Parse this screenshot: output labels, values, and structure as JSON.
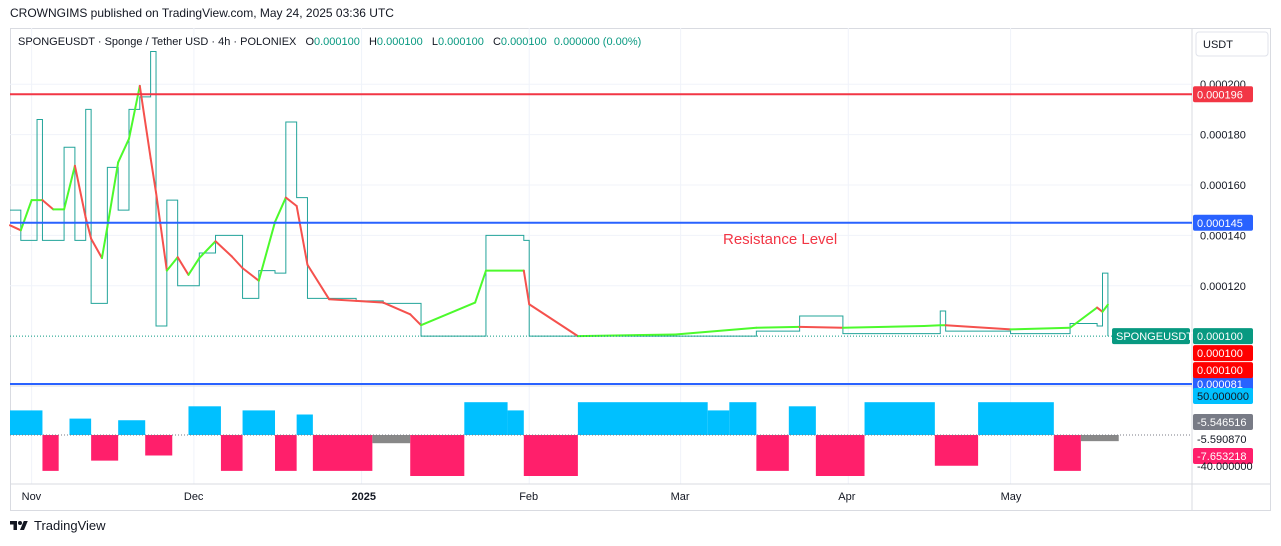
{
  "header": {
    "published": "CROWNGIMS published on TradingView.com, May 24, 2025 03:36 UTC"
  },
  "legend": {
    "symbol": "SPONGEUSDT · Sponge / Tether USD · 4h · POLONIEX",
    "o_label": "O",
    "o_value": "0.000100",
    "h_label": "H",
    "h_value": "0.000100",
    "l_label": "L",
    "l_value": "0.000100",
    "c_label": "C",
    "c_value": "0.000100",
    "change": "0.000000 (0.00%)"
  },
  "currency_button": "USDT",
  "annotation": "Resistance Level",
  "footer": {
    "brand": "TradingView"
  },
  "colors": {
    "red_level": "#f23645",
    "blue_level": "#2962ff",
    "price_line": "#089981",
    "up_segment": "#4cfa2c",
    "down_segment": "#f5514d",
    "osc_pos": "#00c0ff",
    "osc_neg": "#ff1f6b",
    "osc_neutral": "#888888"
  },
  "chart_data": {
    "type": "line",
    "title": "SPONGEUSDT · Sponge / Tether USD · 4h · POLONIEX",
    "x": [
      "Nov",
      "Dec",
      "2025",
      "Feb",
      "Mar",
      "Apr",
      "May"
    ],
    "ylim": [
      8.1e-05,
      0.000212
    ],
    "y_ticks": [
      "0.000200",
      "0.000180",
      "0.000160",
      "0.000140",
      "0.000120"
    ],
    "horizontal_levels": [
      {
        "value": 0.000196,
        "label": "0.000196",
        "color": "#f23645"
      },
      {
        "value": 0.000145,
        "label": "0.000145",
        "color": "#2962ff"
      },
      {
        "value": 8.1e-05,
        "label": "0.000081",
        "color": "#2962ff"
      }
    ],
    "current_price": {
      "value": 0.0001,
      "symbol_tag": "SPONGEUSDT",
      "label": "0.000100"
    },
    "extra_price_tags": [
      "0.000100",
      "0.000100"
    ],
    "price_series": [
      [
        "Oct 28",
        0.00015
      ],
      [
        "Oct 30",
        0.000138
      ],
      [
        "Nov 1",
        0.000138
      ],
      [
        "Nov 2",
        0.000186
      ],
      [
        "Nov 3",
        0.000138
      ],
      [
        "Nov 5",
        0.000138
      ],
      [
        "Nov 7",
        0.000175
      ],
      [
        "Nov 9",
        0.000138
      ],
      [
        "Nov 11",
        0.00019
      ],
      [
        "Nov 12",
        0.000113
      ],
      [
        "Nov 14",
        0.000113
      ],
      [
        "Nov 15",
        0.000167
      ],
      [
        "Nov 17",
        0.00015
      ],
      [
        "Nov 19",
        0.00019
      ],
      [
        "Nov 21",
        0.000195
      ],
      [
        "Nov 23",
        0.000213
      ],
      [
        "Nov 24",
        0.000104
      ],
      [
        "Nov 26",
        0.000154
      ],
      [
        "Nov 28",
        0.00012
      ],
      [
        "Nov 30",
        0.00012
      ],
      [
        "Dec 2",
        0.000133
      ],
      [
        "Dec 5",
        0.00014
      ],
      [
        "Dec 8",
        0.00014
      ],
      [
        "Dec 10",
        0.000115
      ],
      [
        "Dec 13",
        0.000126
      ],
      [
        "Dec 16",
        0.000125
      ],
      [
        "Dec 18",
        0.000185
      ],
      [
        "Dec 20",
        0.000155
      ],
      [
        "Dec 22",
        0.000115
      ],
      [
        "Dec 26",
        0.000115
      ],
      [
        "Dec 31",
        0.000114
      ],
      [
        "Jan 5",
        0.000113
      ],
      [
        "Jan 10",
        0.000113
      ],
      [
        "Jan 12",
        0.0001
      ],
      [
        "Jan 22",
        0.0001
      ],
      [
        "Jan 24",
        0.00014
      ],
      [
        "Jan 31",
        0.000138
      ],
      [
        "Feb 1",
        0.0001
      ],
      [
        "Feb 10",
        0.0001
      ],
      [
        "Feb 28",
        0.0001
      ],
      [
        "Mar 15",
        0.000102
      ],
      [
        "Mar 23",
        0.000108
      ],
      [
        "Mar 31",
        0.000101
      ],
      [
        "Apr 15",
        0.000101
      ],
      [
        "Apr 18",
        0.00011
      ],
      [
        "Apr 19",
        0.000102
      ],
      [
        "May 1",
        0.000101
      ],
      [
        "May 12",
        0.000105
      ],
      [
        "May 17",
        0.000104
      ],
      [
        "May 18",
        0.000125
      ],
      [
        "May 19",
        0.0001
      ]
    ],
    "oscillator": {
      "labels": [
        "50.000000",
        "-5.546516",
        "-5.590870",
        "-7.653218",
        "-40.000000"
      ],
      "ylim": [
        -40,
        50
      ]
    }
  }
}
